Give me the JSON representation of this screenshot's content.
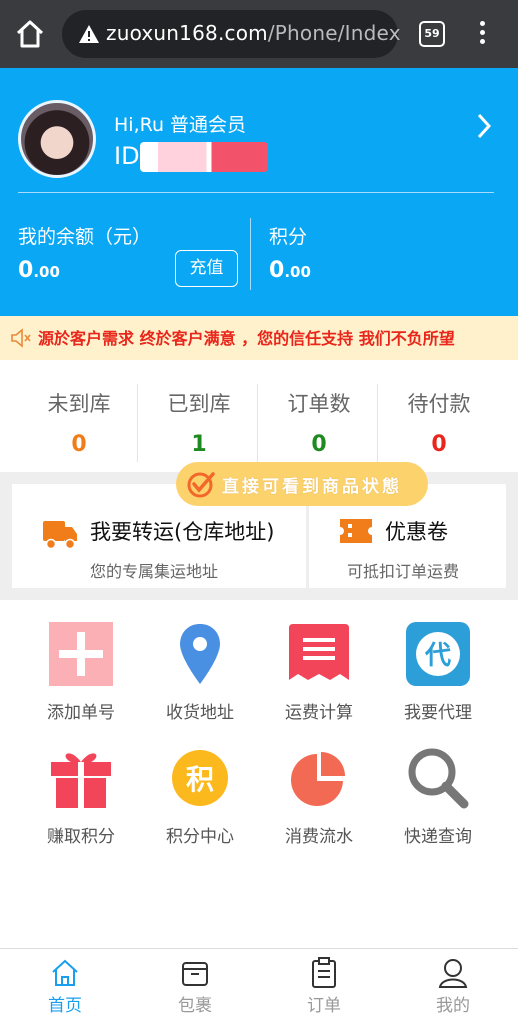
{
  "browser": {
    "url_domain": "zuoxun168.com",
    "url_path": "/Phone/Index",
    "tab_count": "59"
  },
  "profile": {
    "greeting": "Hi,Ru 普通会员",
    "id_label": "ID",
    "balance_label": "我的余额（元）",
    "balance_int": "0",
    "balance_dec": ".00",
    "recharge_label": "充值",
    "points_label": "积分",
    "points_int": "0",
    "points_dec": ".00"
  },
  "notice": {
    "text": "源於客户需求 终於客户满意 ，您的信任支持 我们不负所望"
  },
  "stats": [
    {
      "label": "未到库",
      "value": "0",
      "color": "#f07d1a"
    },
    {
      "label": "已到库",
      "value": "1",
      "color": "#1f8a1f"
    },
    {
      "label": "订单数",
      "value": "0",
      "color": "#1f8a1f"
    },
    {
      "label": "待付款",
      "value": "0",
      "color": "#e8261b"
    }
  ],
  "cards": {
    "transfer_title": "我要转运(仓库地址)",
    "transfer_sub": "您的专属集运地址",
    "coupon_title": "优惠卷",
    "coupon_sub": "可抵扣订单运费"
  },
  "sticker": {
    "text": "直接可看到商品状態"
  },
  "grid": [
    {
      "label": "添加单号",
      "icon": "plus-icon"
    },
    {
      "label": "收货地址",
      "icon": "location-pin-icon"
    },
    {
      "label": "运费计算",
      "icon": "receipt-icon"
    },
    {
      "label": "我要代理",
      "icon": "agent-icon",
      "glyph": "代"
    },
    {
      "label": "赚取积分",
      "icon": "gift-icon"
    },
    {
      "label": "积分中心",
      "icon": "points-coin-icon",
      "glyph": "积"
    },
    {
      "label": "消费流水",
      "icon": "pie-chart-icon"
    },
    {
      "label": "快递查询",
      "icon": "magnifier-icon"
    }
  ],
  "tabbar": [
    {
      "label": "首页",
      "icon": "home-icon",
      "active": true
    },
    {
      "label": "包裹",
      "icon": "package-icon",
      "active": false
    },
    {
      "label": "订单",
      "icon": "order-icon",
      "active": false
    },
    {
      "label": "我的",
      "icon": "user-icon",
      "active": false
    }
  ],
  "colors": {
    "header_blue": "#0aa7f4",
    "accent_orange": "#f07d1a",
    "notice_red": "#e8261b",
    "tab_active": "#1a9ff0"
  }
}
